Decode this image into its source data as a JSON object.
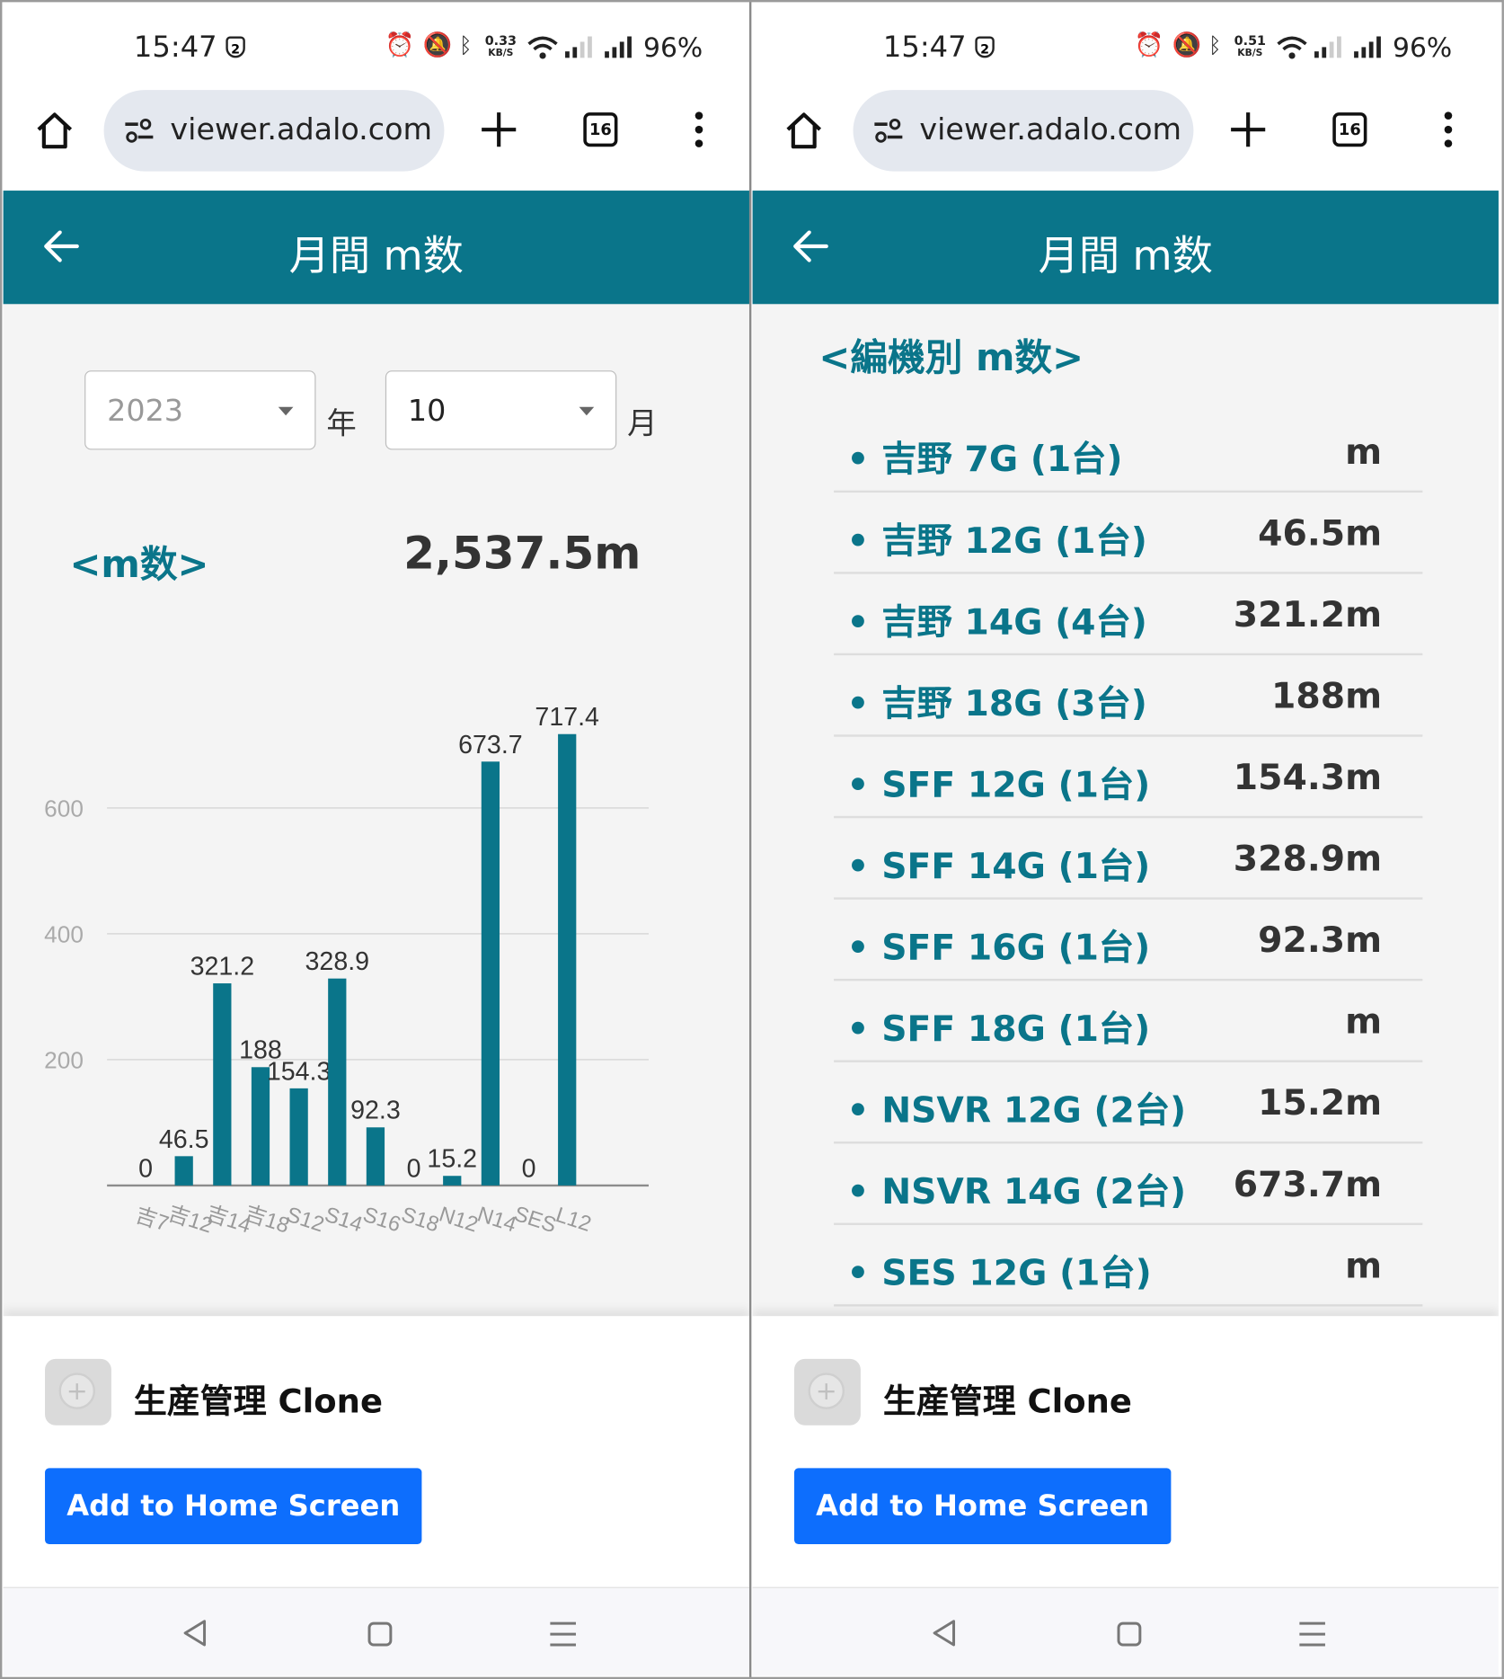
{
  "status_left": {
    "time": "15:47",
    "notif_badge": "2",
    "net_speed_top": "0.33",
    "net_speed_unit": "KB/S",
    "battery": "96%"
  },
  "status_right": {
    "time": "15:47",
    "notif_badge": "2",
    "net_speed_top": "0.51",
    "net_speed_unit": "KB/S",
    "battery": "96%"
  },
  "browser": {
    "url": "viewer.adalo.com",
    "tab_count": "16"
  },
  "header": {
    "title": "月間 m数"
  },
  "filters": {
    "year_value": "2023",
    "year_unit": "年",
    "month_value": "10",
    "month_unit": "月"
  },
  "summary": {
    "label": "<m数>",
    "total": "2,537.5m"
  },
  "chart_data": {
    "type": "bar",
    "categories": [
      "吉7",
      "吉12",
      "吉14",
      "吉18",
      "S12",
      "S14",
      "S16",
      "S18",
      "N12",
      "N14",
      "SES",
      "L12"
    ],
    "values": [
      0,
      46.5,
      321.2,
      188,
      154.3,
      328.9,
      92.3,
      0,
      15.2,
      673.7,
      0,
      717.4
    ],
    "value_labels": [
      "0",
      "46.5",
      "321.2",
      "188",
      "154.3",
      "328.9",
      "92.3",
      "0",
      "15.2",
      "673.7",
      "0",
      "717.4"
    ],
    "y_ticks": [
      200,
      400,
      600
    ],
    "ylim": [
      0,
      760
    ],
    "bar_color": "#0a758a"
  },
  "breakdown": {
    "title": "<編機別 m数>",
    "items": [
      {
        "label": "• 吉野 7G (1台)",
        "value": "m"
      },
      {
        "label": "• 吉野 12G (1台)",
        "value": "46.5m"
      },
      {
        "label": "• 吉野 14G (4台)",
        "value": "321.2m"
      },
      {
        "label": "• 吉野 18G (3台)",
        "value": "188m"
      },
      {
        "label": "• SFF 12G (1台)",
        "value": "154.3m"
      },
      {
        "label": "• SFF 14G (1台)",
        "value": "328.9m"
      },
      {
        "label": "• SFF 16G (1台)",
        "value": "92.3m"
      },
      {
        "label": "• SFF 18G (1台)",
        "value": "m"
      },
      {
        "label": "• NSVR 12G (2台)",
        "value": "15.2m"
      },
      {
        "label": "• NSVR 14G (2台)",
        "value": "673.7m"
      },
      {
        "label": "• SES 12G (1台)",
        "value": "m"
      }
    ]
  },
  "install_banner": {
    "app_name": "生産管理 Clone",
    "button_label": "Add to Home Screen"
  },
  "icons": {
    "home": "home-icon",
    "site_settings": "tune-icon",
    "new_tab": "plus-icon",
    "tabs": "tab-switcher-icon",
    "menu": "more-vert-icon",
    "back": "arrow-left-icon",
    "nav_back": "triangle-back-icon",
    "nav_home": "square-home-icon",
    "nav_recents": "menu-lines-icon"
  },
  "colors": {
    "primary": "#0a758a",
    "button": "#0d6efd"
  }
}
